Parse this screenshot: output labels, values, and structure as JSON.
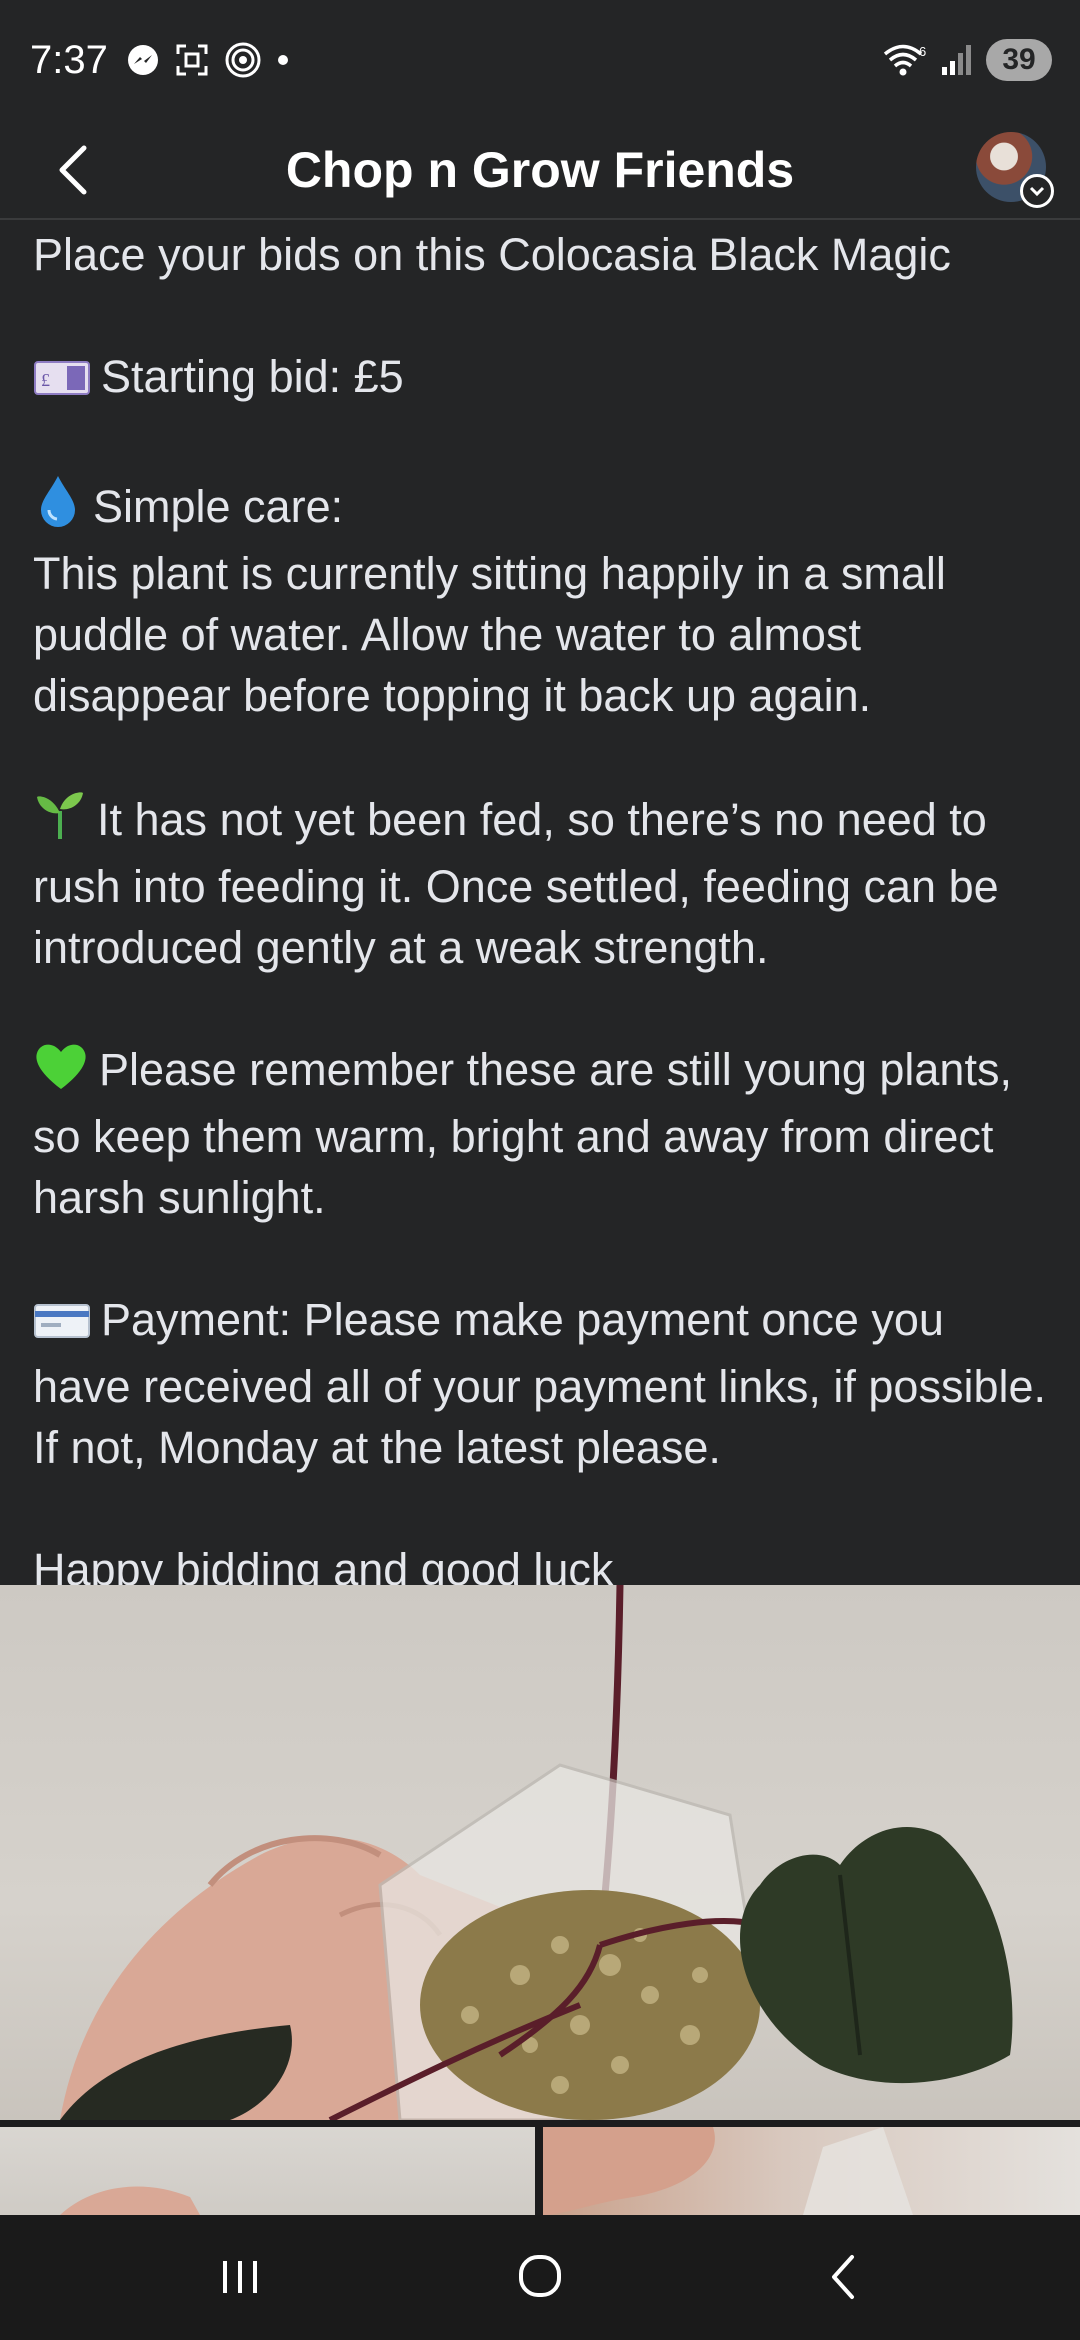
{
  "status_bar": {
    "time": "7:37",
    "left_icons": [
      "messenger-icon",
      "screenshot-icon",
      "hotspot-icon",
      "dot-icon"
    ],
    "right_icons": [
      "wifi-icon",
      "signal-icon"
    ],
    "wifi_badge": "6",
    "battery": "39"
  },
  "header": {
    "title": "Chop n Grow Friends",
    "back_icon": "back-arrow-icon",
    "avatar_icon": "profile-avatar"
  },
  "post": {
    "line1": "Place your bids on this Colocasia Black Magic",
    "starting_bid": "Starting bid: £5",
    "care_heading": "Simple care:",
    "care_text": "This plant is currently sitting happily in a small puddle of water. Allow the water to almost disappear before topping it back up again.",
    "fed_text": "It has not yet been fed, so there’s no need to rush into feeding it. Once settled, feeding can be introduced gently at a weak strength.",
    "young_text": "Please remember these are still young plants, so keep them warm, bright and away from direct harsh sunlight.",
    "payment_text": "Payment: Please make payment once you have received all of your payment links, if possible. If not, Monday at the latest please.",
    "closing": "Happy bidding and good luck",
    "emojis": {
      "bid": "banknote-emoji",
      "care": "droplet-emoji",
      "fed": "seedling-emoji",
      "young": "green-heart-emoji",
      "payment": "credit-card-emoji"
    }
  },
  "nav_bar": {
    "recents_icon": "recents-icon",
    "home_icon": "home-icon",
    "back_icon": "nav-back-icon"
  },
  "colors": {
    "background": "#242526",
    "text": "#e4e6eb",
    "nav_background": "#1a1a1a"
  }
}
